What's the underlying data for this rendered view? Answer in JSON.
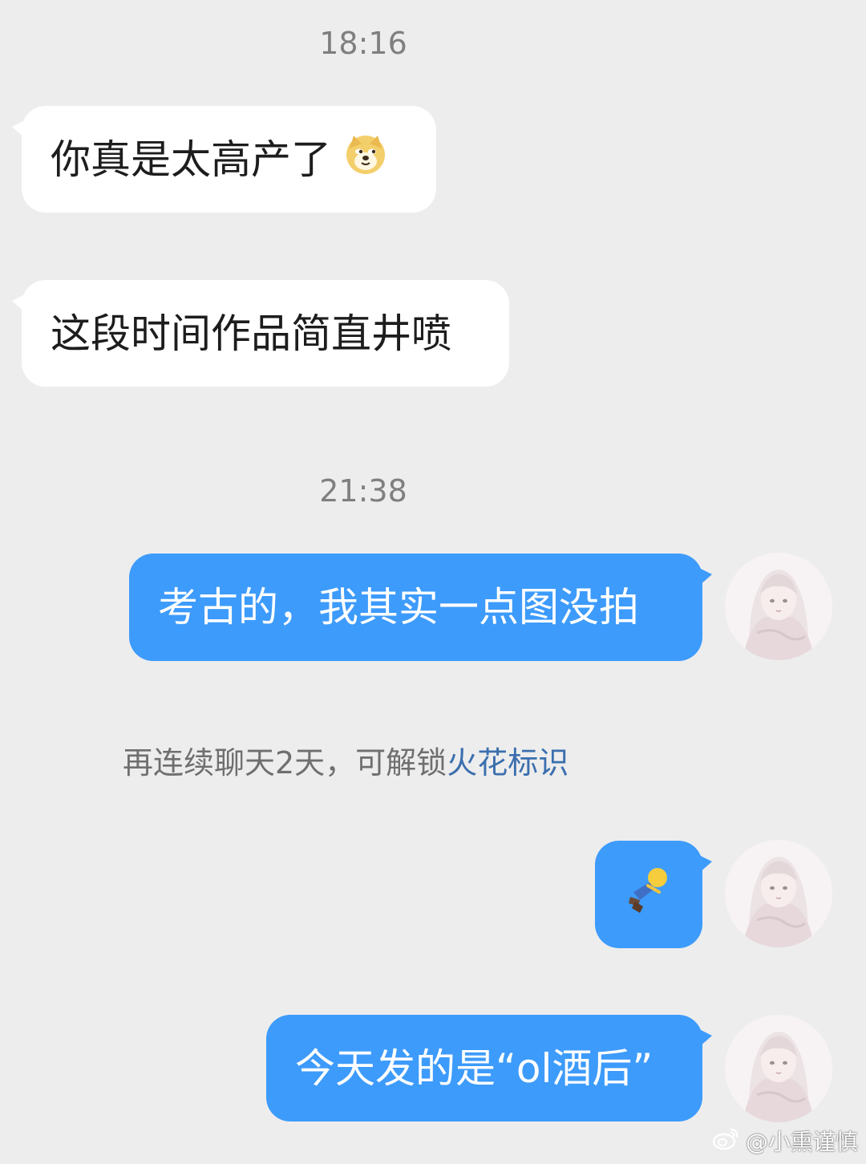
{
  "colors": {
    "background": "#ededed",
    "incoming_bubble": "#ffffff",
    "outgoing_bubble": "#3d9bfb",
    "timestamp_text": "#7f7f7f",
    "notice_link": "#3b6fae"
  },
  "timestamps": [
    "18:16",
    "21:38"
  ],
  "messages": [
    {
      "side": "left",
      "text": "你真是太高产了",
      "emoji": "doge-emoji"
    },
    {
      "side": "left",
      "text": "这段时间作品简直井喷"
    },
    {
      "side": "right",
      "text": "考古的，我其实一点图没拍",
      "avatar": "anime-girl-avatar"
    },
    {
      "side": "right",
      "text": "",
      "emoji": "lying-down-man-emoji",
      "avatar": "anime-girl-avatar"
    },
    {
      "side": "right",
      "text": "今天发的是“ol酒后”",
      "avatar": "anime-girl-avatar"
    }
  ],
  "notice": {
    "prefix": "再连续聊天2天，可解锁",
    "link": "火花标识"
  },
  "watermark": {
    "text": "@小熏谨慎",
    "icon": "weibo-icon"
  }
}
